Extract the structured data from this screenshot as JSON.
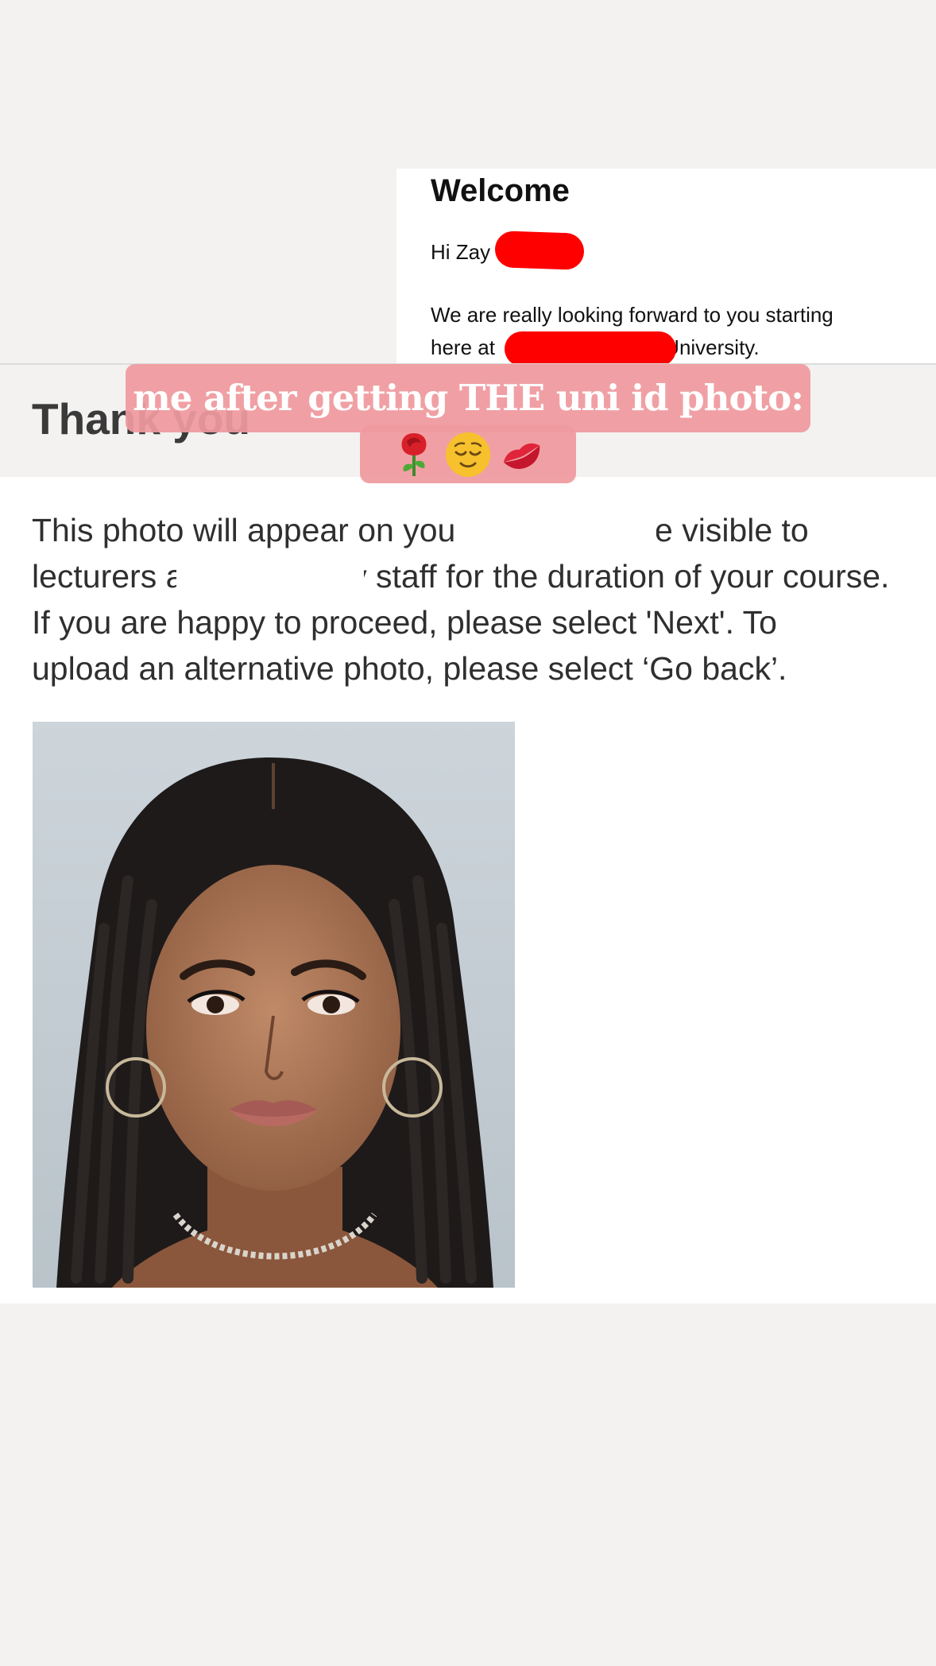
{
  "welcome_email": {
    "title": "Welcome",
    "greeting": "Hi Zay",
    "body_line_1": "We are really looking forward to you starting",
    "body_line_2_start": "here at ",
    "body_line_2_end": "University.",
    "redaction_color": "#ff0000"
  },
  "photo_page": {
    "heading": "Thank you",
    "info_lines": [
      "This photo will appear on your profile and be visible to",
      "lecturers and university staff for the duration of your course.",
      "If you are happy to proceed, please select 'Next'. To",
      "upload an alternative photo, please select ‘Go back’."
    ]
  },
  "story_caption": {
    "text": "me after getting THE uni id photo:",
    "emojis": [
      "rose-icon",
      "relieved-face-icon",
      "kiss-mark-icon"
    ],
    "background_color": "#ef9a9e"
  }
}
